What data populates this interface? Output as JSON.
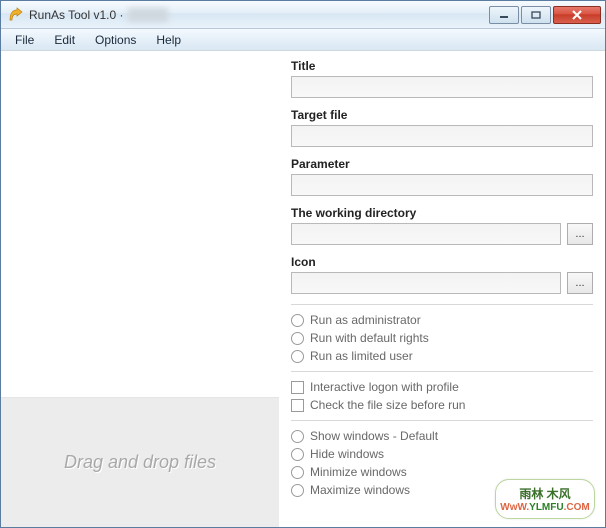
{
  "window": {
    "title": "RunAs Tool v1.0 ·"
  },
  "menu": {
    "file": "File",
    "edit": "Edit",
    "options": "Options",
    "help": "Help"
  },
  "dropzone": {
    "label": "Drag and drop files"
  },
  "fields": {
    "title": {
      "label": "Title",
      "value": ""
    },
    "target": {
      "label": "Target file",
      "value": ""
    },
    "parameter": {
      "label": "Parameter",
      "value": ""
    },
    "workdir": {
      "label": "The working directory",
      "value": "",
      "browse": "..."
    },
    "icon": {
      "label": "Icon",
      "value": "",
      "browse": "..."
    }
  },
  "rights": {
    "admin": "Run as administrator",
    "default": "Run with default rights",
    "limited": "Run as limited user"
  },
  "checks": {
    "interactive": "Interactive logon with profile",
    "filesize": "Check the file size before run"
  },
  "windowmode": {
    "default": "Show windows - Default",
    "hide": "Hide windows",
    "minimize": "Minimize windows",
    "maximize": "Maximize windows"
  },
  "watermark": {
    "line1": "雨林 木风",
    "url_prefix": "WwW.",
    "url_mid": "YLMFU",
    "url_suffix": ".COM"
  }
}
